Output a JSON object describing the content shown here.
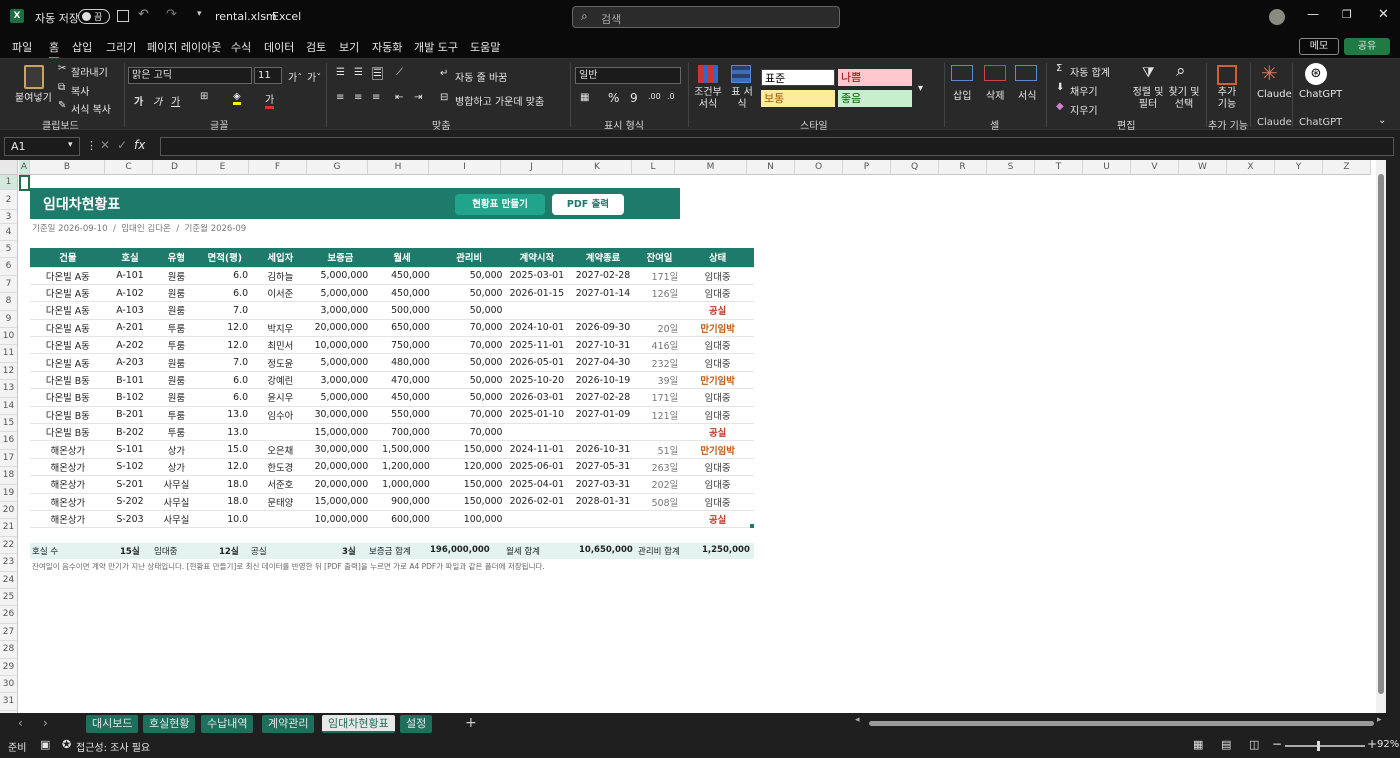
{
  "titlebar": {
    "autosave": "자동 저장",
    "toggle": "끔",
    "filename": "rental.xlsm",
    "app": "Excel",
    "search_placeholder": "검색"
  },
  "menu": [
    "파일",
    "홈",
    "삽입",
    "그리기",
    "페이지 레이아웃",
    "수식",
    "데이터",
    "검토",
    "보기",
    "자동화",
    "개발 도구",
    "도움말"
  ],
  "menu_right": {
    "comment": "메모",
    "share": "공유"
  },
  "ribbon": {
    "clipboard": {
      "paste": "붙여넣기",
      "cut": "잘라내기",
      "copy": "복사",
      "format_painter": "서식 복사",
      "group": "클립보드"
    },
    "font": {
      "name": "맑은 고딕",
      "size": "11",
      "group": "글꼴"
    },
    "align": {
      "wrap": "자동 줄 바꿈",
      "merge": "병합하고 가운데 맞춤",
      "group": "맞춤"
    },
    "number": {
      "format": "일반",
      "group": "표시 형식"
    },
    "styles": {
      "cond": "조건부 서식",
      "table": "표 서식",
      "normal": "표준",
      "bad": "나쁨",
      "neutral": "보통",
      "good": "좋음",
      "group": "스타일"
    },
    "cells": {
      "insert": "삽입",
      "delete": "삭제",
      "format": "서식",
      "group": "셀"
    },
    "editing": {
      "autosum": "자동 합계",
      "fill": "채우기",
      "clear": "지우기",
      "sort": "정렬 및 필터",
      "find": "찾기 및 선택",
      "group": "편집"
    },
    "addins": {
      "label": "추가 기능",
      "group": "추가 기능"
    },
    "claude": {
      "label": "Claude",
      "group": "Claude"
    },
    "chatgpt": {
      "label": "ChatGPT",
      "group": "ChatGPT"
    }
  },
  "formula": {
    "namebox": "A1",
    "fx": "fx"
  },
  "columns": [
    "A",
    "B",
    "C",
    "D",
    "E",
    "F",
    "G",
    "H",
    "I",
    "J",
    "K",
    "L",
    "M",
    "N",
    "O",
    "P",
    "Q",
    "R",
    "S",
    "T",
    "U",
    "V",
    "W",
    "X",
    "Y",
    "Z"
  ],
  "rows": [
    "1",
    "2",
    "3",
    "4",
    "5",
    "6",
    "7",
    "8",
    "9",
    "10",
    "11",
    "12",
    "13",
    "14",
    "15",
    "16",
    "17",
    "18",
    "19",
    "20",
    "21",
    "22",
    "23",
    "24",
    "25",
    "26",
    "27",
    "28",
    "29",
    "30",
    "31",
    "32"
  ],
  "sheet": {
    "title": "임대차현황표",
    "btn_make": "현황표 만들기",
    "btn_pdf": "PDF 출력",
    "subline": "기준일 2026-09-10  /  임대인 김다온  /  기준월 2026-09",
    "headers": [
      "건물",
      "호실",
      "유형",
      "면적(평)",
      "세입자",
      "보증금",
      "월세",
      "관리비",
      "계약시작",
      "계약종료",
      "잔여일",
      "상태"
    ],
    "rows": [
      [
        "다온빌 A동",
        "A-101",
        "원룸",
        "6.0",
        "김하늘",
        "5,000,000",
        "450,000",
        "50,000",
        "2025-03-01",
        "2027-02-28",
        "171일",
        "임대중"
      ],
      [
        "다온빌 A동",
        "A-102",
        "원룸",
        "6.0",
        "이서준",
        "5,000,000",
        "450,000",
        "50,000",
        "2026-01-15",
        "2027-01-14",
        "126일",
        "임대중"
      ],
      [
        "다온빌 A동",
        "A-103",
        "원룸",
        "7.0",
        "",
        "3,000,000",
        "500,000",
        "50,000",
        "",
        "",
        "",
        "공실"
      ],
      [
        "다온빌 A동",
        "A-201",
        "투룸",
        "12.0",
        "박지우",
        "20,000,000",
        "650,000",
        "70,000",
        "2024-10-01",
        "2026-09-30",
        "20일",
        "만기임박"
      ],
      [
        "다온빌 A동",
        "A-202",
        "투룸",
        "12.0",
        "최민서",
        "10,000,000",
        "750,000",
        "70,000",
        "2025-11-01",
        "2027-10-31",
        "416일",
        "임대중"
      ],
      [
        "다온빌 A동",
        "A-203",
        "원룸",
        "7.0",
        "정도윤",
        "5,000,000",
        "480,000",
        "50,000",
        "2026-05-01",
        "2027-04-30",
        "232일",
        "임대중"
      ],
      [
        "다온빌 B동",
        "B-101",
        "원룸",
        "6.0",
        "강예린",
        "3,000,000",
        "470,000",
        "50,000",
        "2025-10-20",
        "2026-10-19",
        "39일",
        "만기임박"
      ],
      [
        "다온빌 B동",
        "B-102",
        "원룸",
        "6.0",
        "윤시우",
        "5,000,000",
        "450,000",
        "50,000",
        "2026-03-01",
        "2027-02-28",
        "171일",
        "임대중"
      ],
      [
        "다온빌 B동",
        "B-201",
        "투룸",
        "13.0",
        "임수아",
        "30,000,000",
        "550,000",
        "70,000",
        "2025-01-10",
        "2027-01-09",
        "121일",
        "임대중"
      ],
      [
        "다온빌 B동",
        "B-202",
        "투룸",
        "13.0",
        "",
        "15,000,000",
        "700,000",
        "70,000",
        "",
        "",
        "",
        "공실"
      ],
      [
        "해온상가",
        "S-101",
        "상가",
        "15.0",
        "오은채",
        "30,000,000",
        "1,500,000",
        "150,000",
        "2024-11-01",
        "2026-10-31",
        "51일",
        "만기임박"
      ],
      [
        "해온상가",
        "S-102",
        "상가",
        "12.0",
        "한도경",
        "20,000,000",
        "1,200,000",
        "120,000",
        "2025-06-01",
        "2027-05-31",
        "263일",
        "임대중"
      ],
      [
        "해온상가",
        "S-201",
        "사무실",
        "18.0",
        "서준호",
        "20,000,000",
        "1,000,000",
        "150,000",
        "2025-04-01",
        "2027-03-31",
        "202일",
        "임대중"
      ],
      [
        "해온상가",
        "S-202",
        "사무실",
        "18.0",
        "문태양",
        "15,000,000",
        "900,000",
        "150,000",
        "2026-02-01",
        "2028-01-31",
        "508일",
        "임대중"
      ],
      [
        "해온상가",
        "S-203",
        "사무실",
        "10.0",
        "",
        "10,000,000",
        "600,000",
        "100,000",
        "",
        "",
        "",
        "공실"
      ]
    ],
    "summary": {
      "units_label": "호실 수",
      "units": "15실",
      "occupied_label": "임대중",
      "occupied": "12실",
      "vacant_label": "공실",
      "vacant": "3실",
      "deposit_label": "보증금 합계",
      "deposit": "196,000,000",
      "rent_label": "월세 합계",
      "rent": "10,650,000",
      "mgmt_label": "관리비 합계",
      "mgmt": "1,250,000"
    },
    "note": "잔여일이 음수이면 계약 만기가 지난 상태입니다. [현황표 만들기]로 최신 데이터를 반영한 뒤 [PDF 출력]을 누르면 가로 A4 PDF가 파일과 같은 폴더에 저장됩니다."
  },
  "tabs": [
    "대시보드",
    "호실현황",
    "수납내역",
    "계약관리",
    "임대차현황표",
    "설정"
  ],
  "status": {
    "ready": "준비",
    "access": "접근성: 조사 필요",
    "zoom": "92%"
  },
  "colors": {
    "teal": "#1e7a6a",
    "warn": "#c55a11",
    "vacant": "#c0392b"
  }
}
